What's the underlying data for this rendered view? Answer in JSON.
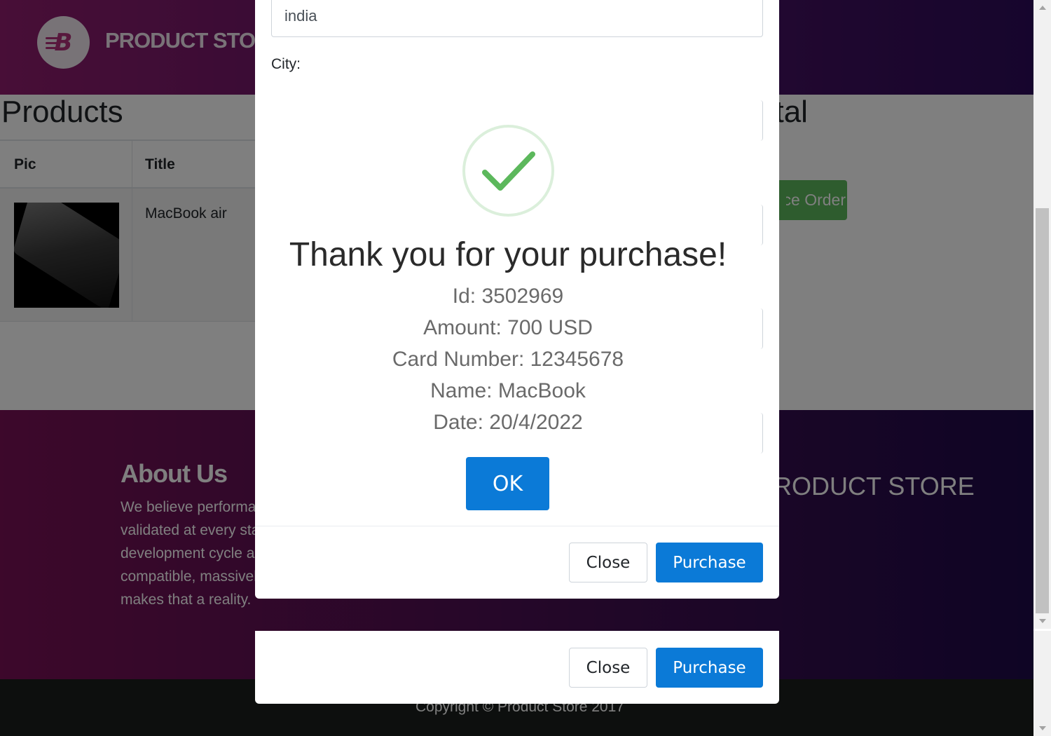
{
  "navbar": {
    "brand": "PRODUCT STORE"
  },
  "products": {
    "heading": "Products",
    "total_heading": "Total",
    "columns": [
      "Pic",
      "Title"
    ],
    "rows": [
      {
        "title": "MacBook air"
      }
    ],
    "place_order_label": "Place Order"
  },
  "footer": {
    "about_title": "About Us",
    "about_lines": [
      "We believe performance needs to be",
      "validated at every stage of the software",
      "development cycle and our open source",
      "compatible, massively scalable platform",
      "makes that a reality."
    ],
    "brand": "PRODUCT STORE",
    "copyright": "Copyright © Product Store 2017"
  },
  "order_modal": {
    "country_value": "india",
    "city_label": "City:",
    "close_label": "Close",
    "purchase_label": "Purchase"
  },
  "alert": {
    "title": "Thank you for your purchase!",
    "lines": [
      "Id: 3502969",
      "Amount: 700 USD",
      "Card Number: 12345678",
      "Name: MacBook",
      "Date: 20/4/2022"
    ],
    "ok_label": "OK",
    "success_color": "#5cb85c",
    "accent_color": "#0b7ad7"
  },
  "icons": {
    "logo": "store-logo-icon",
    "success": "checkmark-icon"
  }
}
